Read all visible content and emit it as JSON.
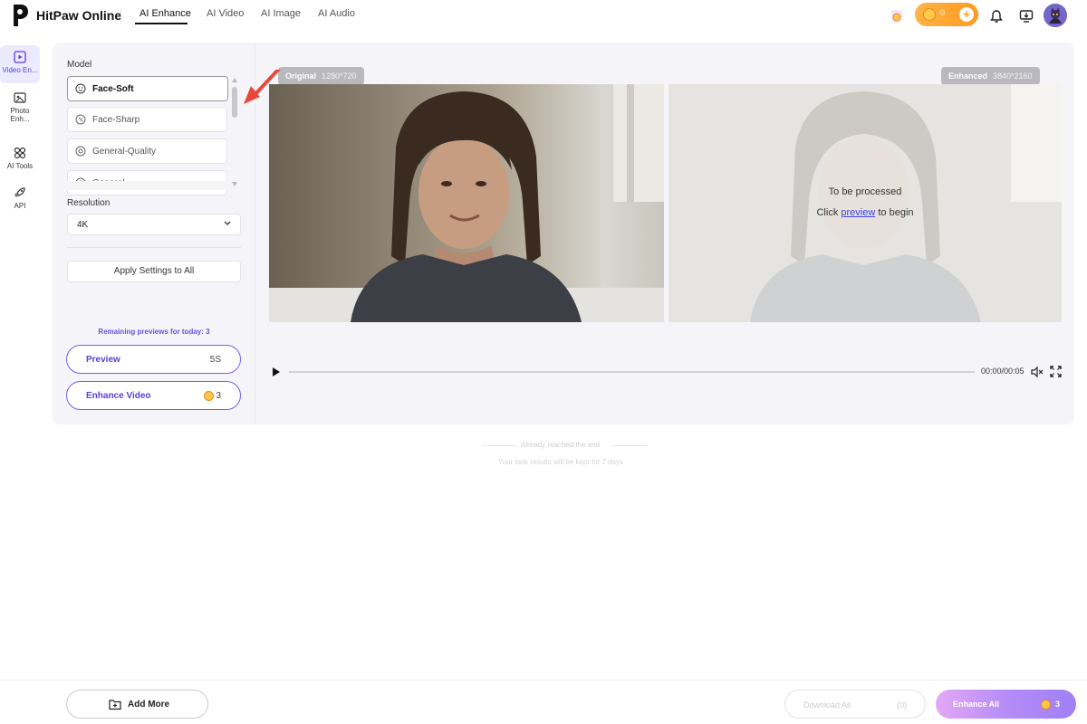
{
  "topbar": {
    "brand": "HitPaw Online",
    "nav": [
      "AI Enhance",
      "AI Video",
      "AI Image",
      "AI Audio"
    ],
    "coins": "0",
    "plus": "+"
  },
  "rail": [
    {
      "label": "Video En..."
    },
    {
      "label": "Photo Enh..."
    },
    {
      "label": "AI Tools"
    },
    {
      "label": "API"
    }
  ],
  "settings": {
    "model_label": "Model",
    "models": [
      "Face-Soft",
      "Face-Sharp",
      "General-Quality",
      "General"
    ],
    "selected_model": "Face-Soft",
    "resolution_label": "Resolution",
    "resolution_value": "4K",
    "apply_label": "Apply Settings to All",
    "remaining": "Remaining previews for today: 3",
    "preview_label": "Preview",
    "preview_duration": "5S",
    "enhance_label": "Enhance Video",
    "enhance_cost": "3"
  },
  "preview": {
    "original_tag": "Original",
    "original_res": "1280*720",
    "enhanced_tag": "Enhanced",
    "enhanced_res": "3840*2160",
    "processed_title": "To be processed",
    "processed_prefix": "Click",
    "processed_link": "preview",
    "processed_suffix": "to begin",
    "time": "00:00/00:05"
  },
  "list_end": {
    "line1": "Already reached the end",
    "line2": "Your task results will be kept for 7 days"
  },
  "bottombar": {
    "add_more": "Add More",
    "download_all": "Download All",
    "download_count": "(0)",
    "enhance_all": "Enhance All",
    "enhance_cost": "3"
  },
  "colors": {
    "accent": "#6b4fe0",
    "coin_orange": "#ff9a1f",
    "panel_bg": "#f5f5f9"
  }
}
